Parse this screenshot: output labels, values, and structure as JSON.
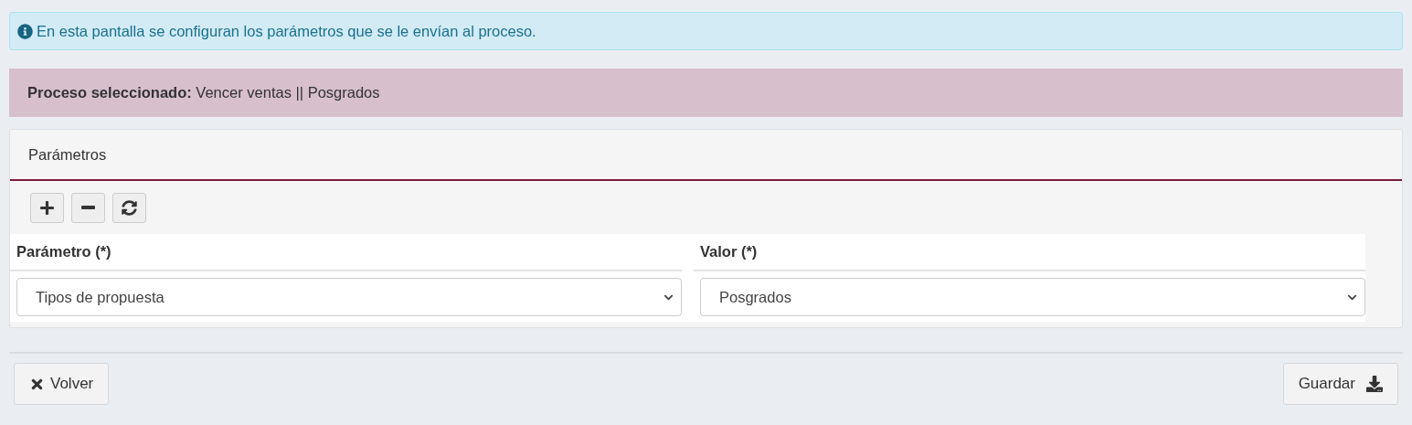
{
  "info": {
    "text": "En esta pantalla se configuran los parámetros que se le envían al proceso."
  },
  "process": {
    "text": "**Proceso seleccionado:** Vencer ventas || Posgrados"
  },
  "panel": {
    "title": "Parámetros",
    "toolbar": [
      {
        "kind": "add"
      },
      {
        "kind": "remove"
      },
      {
        "kind": "refresh"
      }
    ],
    "columns": [
      "Parámetro (*)",
      "Valor (*)"
    ],
    "rows": [
      {
        "parameter": "Tipos de propuesta",
        "value": "Posgrados"
      }
    ]
  },
  "footer": {
    "back": "Volver",
    "save": "Guardar"
  }
}
